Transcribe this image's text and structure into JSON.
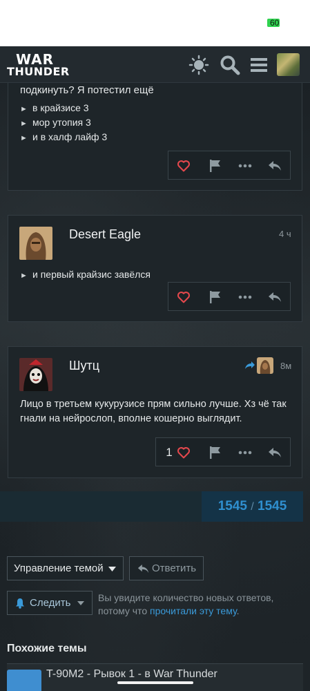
{
  "status": {
    "battery": "60"
  },
  "header": {
    "logo_line1": "WAR",
    "logo_line2": "THUNDER"
  },
  "posts": [
    {
      "text_top": "подкинуть? Я потестил ещё",
      "bullets": [
        "в крайзисе 3",
        "мор утопия 3",
        "и в халф лайф 3"
      ]
    },
    {
      "author": "Desert Eagle",
      "time": "4 ч",
      "bullets": [
        "и первый крайзис завёлся"
      ]
    },
    {
      "author": "Шутц",
      "time": "8м",
      "text": "Лицо в третьем кукурузисе прям сильно лучше. Хз чё так гнали на нейрослоп, вполне кошерно выглядит.",
      "likes": "1"
    }
  ],
  "pager": {
    "current": "1545",
    "sep": "/",
    "total": "1545"
  },
  "controls": {
    "manage_label": "Управление темой",
    "reply_label": "Ответить",
    "follow_label": "Следить",
    "help_text": "Вы увидите количество новых ответов, потому что ",
    "help_link": "прочитали эту тему",
    "help_end": "."
  },
  "similar": {
    "title": "Похожие темы",
    "first_item": "T-90M2 - Рывок 1 - в War Thunder"
  },
  "colors": {
    "accent": "#3a9ad9",
    "heart": "#e5484d",
    "pager_bg": "#143347"
  }
}
